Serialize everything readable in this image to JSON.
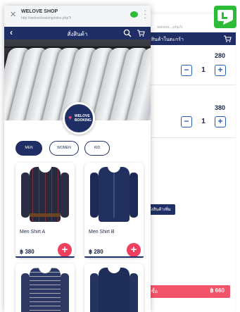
{
  "browser": {
    "site_title": "WELOVE SHOP",
    "url": "http://welovebookingindex.php?i",
    "close_icon": "close-icon",
    "menu_icon": "more-vertical-icon"
  },
  "header": {
    "title": "สั่งสินค้า",
    "back_icon": "back-arrow-icon",
    "search_icon": "search-icon",
    "cart_icon": "cart-icon",
    "color": "#1f2e64"
  },
  "logo": {
    "line1": "WELOVE",
    "line2": "BOOKING"
  },
  "filters": [
    {
      "label": "MEN",
      "active": true
    },
    {
      "label": "WOMEN",
      "active": false
    },
    {
      "label": "KID",
      "active": false
    }
  ],
  "products": [
    {
      "name": "Men Shirt A",
      "price": "฿ 380",
      "add_icon": "plus-icon"
    },
    {
      "name": "Men Shirt B",
      "price": "฿ 280",
      "add_icon": "plus-icon"
    },
    {
      "name": "",
      "price": ""
    },
    {
      "name": "",
      "price": ""
    }
  ],
  "cart": {
    "title": "รสินค้าในตะกร้า",
    "items": [
      {
        "price": "280",
        "qty": "1"
      },
      {
        "price": "380",
        "qty": "1"
      }
    ],
    "more_button": "สั่งสินค้าเพิ่ม",
    "checkout_label": "ซื้อ",
    "total": "฿ 660"
  },
  "line_badge": {
    "icon": "line-app-icon",
    "letter": "L",
    "color": "#2dbb3a"
  },
  "colors": {
    "accent": "#ee3f5f",
    "primary": "#1f2e64"
  }
}
